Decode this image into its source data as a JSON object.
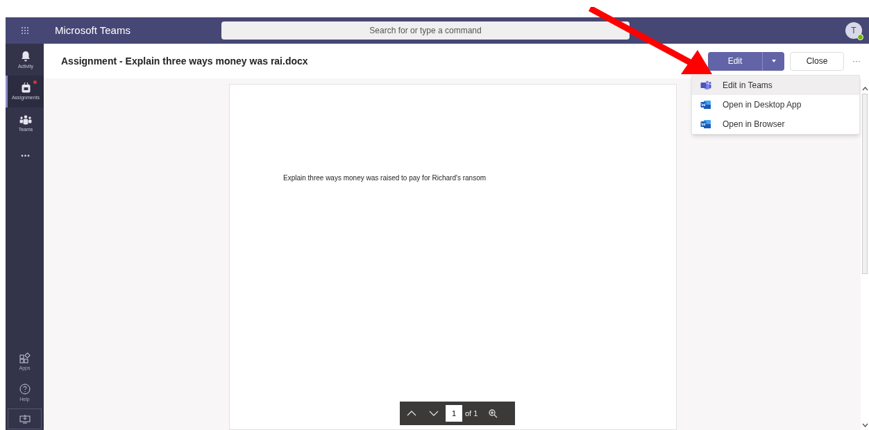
{
  "header": {
    "app_title": "Microsoft Teams",
    "search": {
      "placeholder": "Search for or type a command"
    },
    "avatar": "T"
  },
  "rail": {
    "items": [
      {
        "kind": "activity",
        "label": "Activity",
        "selected": false
      },
      {
        "kind": "assignments",
        "label": "Assignments",
        "selected": true,
        "badge": true
      },
      {
        "kind": "teams",
        "label": "Teams",
        "selected": false
      },
      {
        "kind": "more",
        "label": "•••",
        "selected": false
      }
    ],
    "bottom": [
      {
        "kind": "apps",
        "label": "Apps"
      },
      {
        "kind": "help",
        "label": "Help"
      },
      {
        "kind": "download"
      }
    ]
  },
  "document": {
    "title": "Assignment - Explain three ways money was rai.docx",
    "edit_button": "Edit",
    "close_button": "Close",
    "more": "···",
    "menu": [
      {
        "kind": "teams",
        "label": "Edit in Teams",
        "selected": true
      },
      {
        "kind": "word",
        "label": "Open in Desktop App",
        "selected": false
      },
      {
        "kind": "word",
        "label": "Open in Browser",
        "selected": false
      }
    ],
    "page_text": "Explain three ways money was raised to pay for Richard's ransom",
    "pager": {
      "page": "1",
      "of": "of 1"
    }
  }
}
